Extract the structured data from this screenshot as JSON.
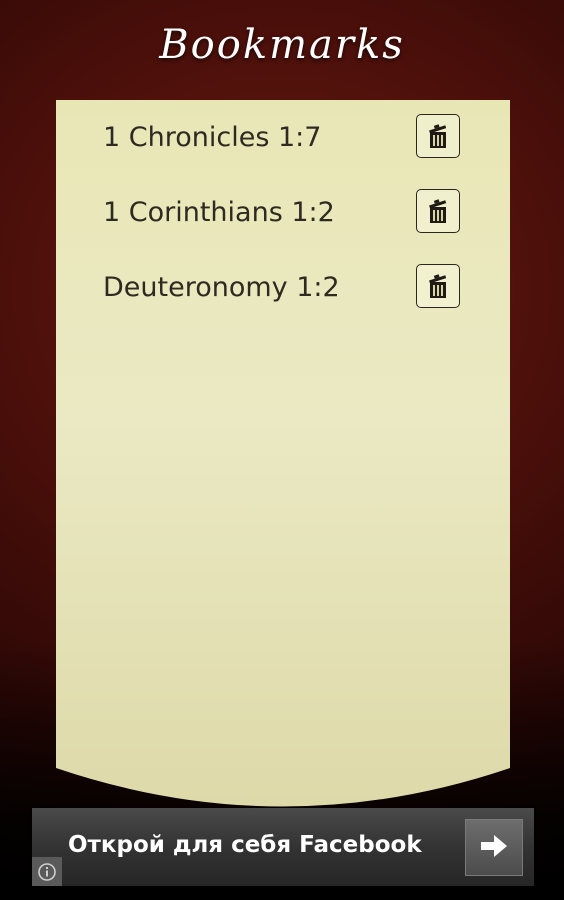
{
  "header": {
    "title": "Bookmarks"
  },
  "bookmarks": [
    {
      "label": "1 Chronicles 1:7",
      "delete_icon": "trash-icon"
    },
    {
      "label": "1 Corinthians 1:2",
      "delete_icon": "trash-icon"
    },
    {
      "label": "Deuteronomy 1:2",
      "delete_icon": "trash-icon"
    }
  ],
  "ad": {
    "text": "Открой для себя Facebook",
    "arrow_icon": "arrow-right-icon",
    "info_icon": "info-icon"
  },
  "colors": {
    "background": "#4a0f0a",
    "paper": "#ecebc0",
    "text": "#2e2a22",
    "ad_background": "#333333"
  }
}
